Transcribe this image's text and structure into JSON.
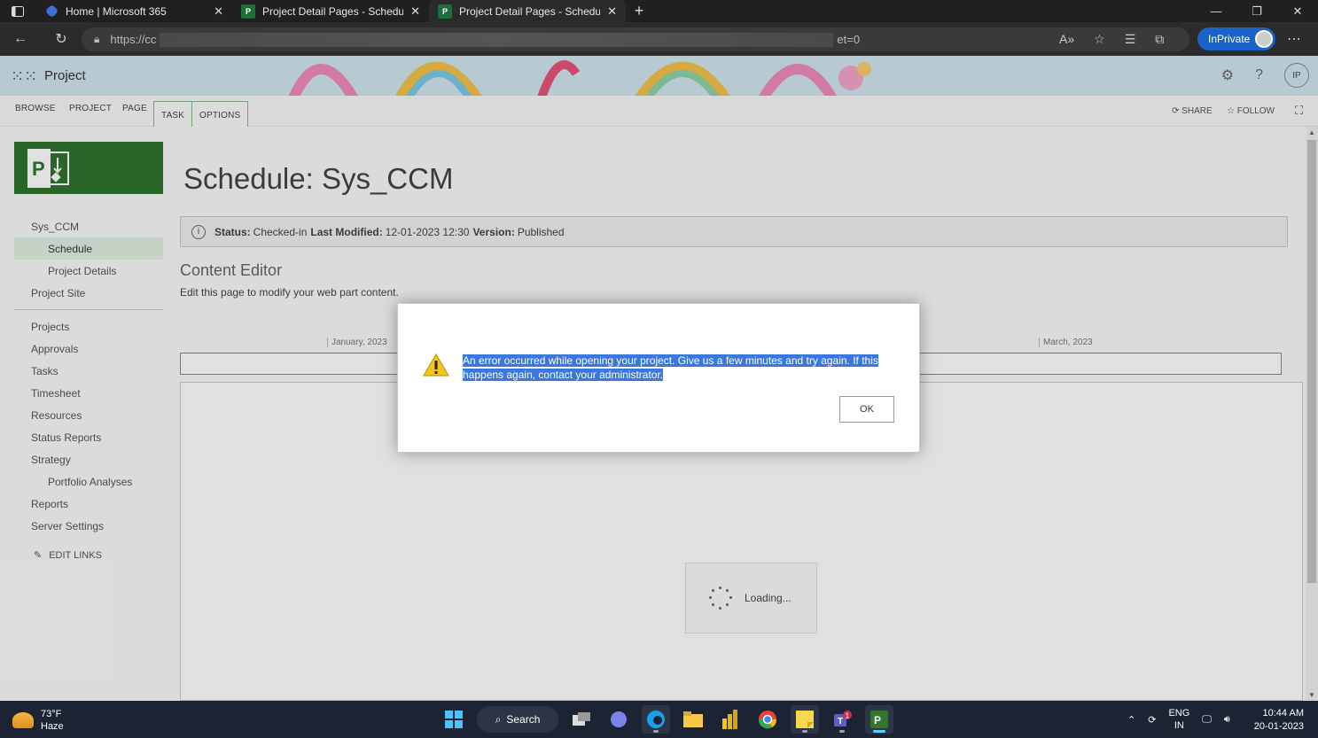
{
  "browser": {
    "tabs": [
      {
        "title": "Home | Microsoft 365",
        "active": false
      },
      {
        "title": "Project Detail Pages - Schedule",
        "active": false
      },
      {
        "title": "Project Detail Pages - Schedule",
        "active": true
      }
    ],
    "url_start": "https://cc",
    "url_end": "et=0",
    "inprivate_label": "InPrivate"
  },
  "suite": {
    "app_name": "Project",
    "avatar_initials": "IP"
  },
  "ribbon": {
    "tabs": [
      "BROWSE",
      "PROJECT",
      "PAGE",
      "TASK",
      "OPTIONS"
    ],
    "share": "SHARE",
    "follow": "FOLLOW"
  },
  "leftnav": {
    "items": [
      {
        "label": "Sys_CCM"
      },
      {
        "label": "Schedule",
        "selected": true
      },
      {
        "label": "Project Details"
      },
      {
        "label": "Project Site"
      }
    ],
    "items2": [
      {
        "label": "Projects"
      },
      {
        "label": "Approvals"
      },
      {
        "label": "Tasks"
      },
      {
        "label": "Timesheet"
      },
      {
        "label": "Resources"
      },
      {
        "label": "Status Reports"
      },
      {
        "label": "Strategy"
      },
      {
        "label": "Portfolio Analyses"
      },
      {
        "label": "Reports"
      },
      {
        "label": "Server Settings"
      }
    ],
    "edit_links": "EDIT LINKS"
  },
  "main": {
    "title": "Schedule: Sys_CCM",
    "status": {
      "status_label": "Status:",
      "status_value": "Checked-in",
      "modified_label": "Last Modified:",
      "modified_value": "12-01-2023 12:30",
      "version_label": "Version:",
      "version_value": "Published"
    },
    "content_editor_title": "Content Editor",
    "content_editor_desc": "Edit this page to modify your web part content.",
    "timeline_labels": [
      "January, 2023",
      "March, 2023"
    ],
    "loading": "Loading..."
  },
  "dialog": {
    "message": "An error occurred while opening your project. Give us a few minutes and try again. If this happens again, contact your administrator.",
    "ok_label": "OK"
  },
  "taskbar": {
    "temperature": "73°F",
    "weather": "Haze",
    "search_label": "Search",
    "lang_top": "ENG",
    "lang_bottom": "IN",
    "time": "10:44 AM",
    "date": "20-01-2023",
    "teams_badge": "1"
  },
  "colors": {
    "project_green": "#31752f",
    "selection_blue": "#3a78e0",
    "inprivate_blue": "#1a62c7"
  }
}
